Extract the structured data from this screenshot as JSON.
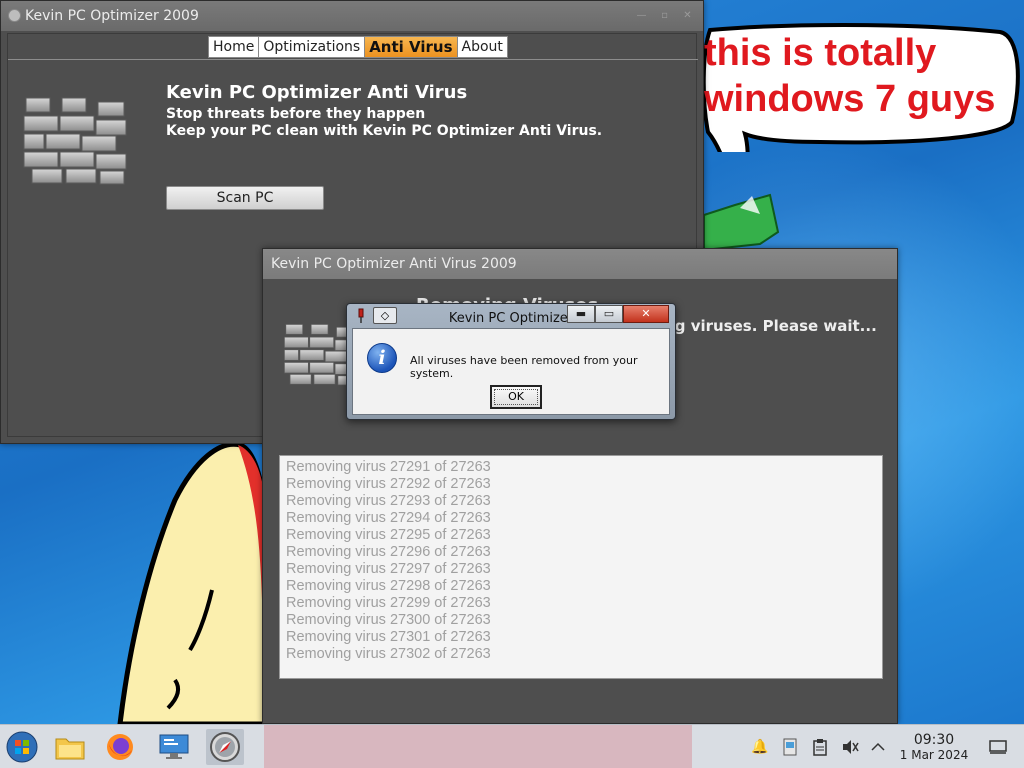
{
  "desktop": {
    "speech_bubble_line1": "this is totally",
    "speech_bubble_line2": "windows 7 guys",
    "colors": {
      "bubble_text": "#e0191f",
      "wallpaper": "#1b7fd0"
    }
  },
  "main_window": {
    "title": "Kevin PC Optimizer 2009",
    "tabs": [
      {
        "label": "Home"
      },
      {
        "label": "Optimizations"
      },
      {
        "label": "Anti Virus",
        "active": true
      },
      {
        "label": "About"
      }
    ],
    "heading": "Kevin PC Optimizer Anti Virus",
    "subheading1": "Stop threats before they happen",
    "subheading2": "Keep your PC clean with Kevin PC Optimizer Anti Virus.",
    "scan_button": "Scan PC",
    "icon": "firewall-icon"
  },
  "av_window": {
    "title": "Kevin PC Optimizer Anti Virus 2009",
    "heading": "Removing Viruses",
    "subheading": "Kevin Anti Virus is quarantining viruses. Please wait...",
    "log": [
      "Removing virus 27291 of 27263",
      "Removing virus 27292 of 27263",
      "Removing virus 27293 of 27263",
      "Removing virus 27294 of 27263",
      "Removing virus 27295 of 27263",
      "Removing virus 27296 of 27263",
      "Removing virus 27297 of 27263",
      "Removing virus 27298 of 27263",
      "Removing virus 27299 of 27263",
      "Removing virus 27300 of 27263",
      "Removing virus 27301 of 27263",
      "Removing virus 27302 of 27263"
    ]
  },
  "dialog": {
    "title": "Kevin PC Optimizer",
    "message": "All viruses have been removed from your system.",
    "ok_label": "OK",
    "diamond_glyph": "◇",
    "min_glyph": "▬",
    "max_glyph": "▭",
    "close_glyph": "✕"
  },
  "taskbar": {
    "apps": [
      "start-orb-icon",
      "file-manager-icon",
      "firefox-icon",
      "system-settings-icon",
      "safari-icon"
    ],
    "clock_time": "09:30",
    "clock_date": "1 Mar 2024",
    "tray": [
      "notifications-icon",
      "network-icon",
      "clipboard-icon",
      "volume-muted-icon",
      "tray-expand-icon",
      "show-desktop-icon"
    ]
  }
}
